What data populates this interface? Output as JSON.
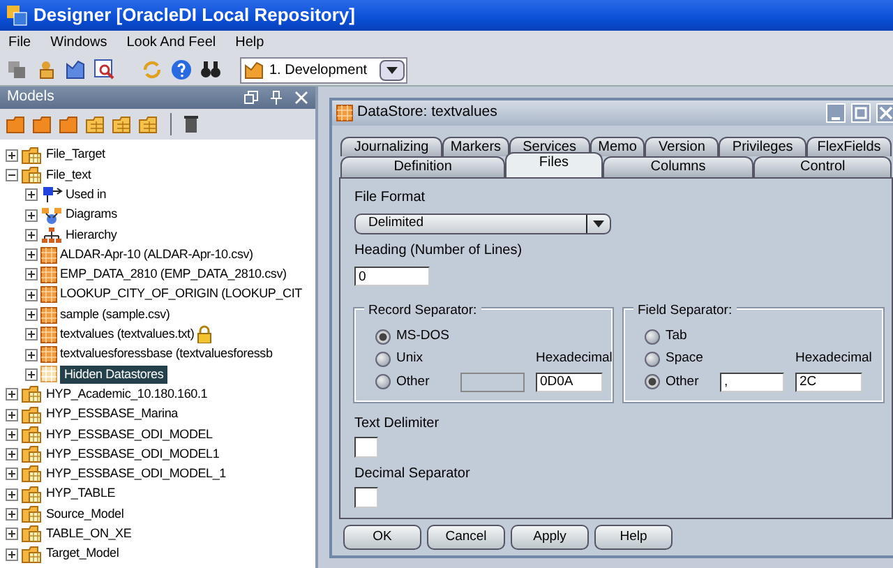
{
  "window": {
    "title": "Designer [OracleDI Local Repository]"
  },
  "menu": [
    "File",
    "Windows",
    "Look And Feel",
    "Help"
  ],
  "toolbar": {
    "context": "1. Development"
  },
  "models_panel": {
    "title": "Models",
    "tree": [
      {
        "label": "File_Target",
        "kind": "model",
        "expanded": false,
        "selected": false
      },
      {
        "label": "File_text",
        "kind": "model",
        "expanded": true,
        "selected": false,
        "children": [
          {
            "label": "Used in",
            "kind": "usedin",
            "expanded": false,
            "selected": false
          },
          {
            "label": "Diagrams",
            "kind": "diagrams",
            "expanded": false,
            "selected": false
          },
          {
            "label": "Hierarchy",
            "kind": "hierarchy",
            "expanded": false,
            "selected": false
          },
          {
            "label": "ALDAR-Apr-10 (ALDAR-Apr-10.csv)",
            "kind": "datastore",
            "expanded": false,
            "selected": false
          },
          {
            "label": "EMP_DATA_2810 (EMP_DATA_2810.csv)",
            "kind": "datastore",
            "expanded": false,
            "selected": false
          },
          {
            "label": "LOOKUP_CITY_OF_ORIGIN (LOOKUP_CIT",
            "kind": "datastore",
            "expanded": false,
            "selected": false
          },
          {
            "label": "sample (sample.csv)",
            "kind": "datastore",
            "expanded": false,
            "selected": false
          },
          {
            "label": "textvalues (textvalues.txt)",
            "kind": "datastore",
            "expanded": false,
            "selected": false,
            "locked": true
          },
          {
            "label": "textvaluesforessbase (textvaluesforessb",
            "kind": "datastore",
            "expanded": false,
            "selected": false
          },
          {
            "label": "Hidden Datastores",
            "kind": "hidden",
            "expanded": false,
            "selected": true
          }
        ]
      },
      {
        "label": "HYP_Academic_10.180.160.1",
        "kind": "model",
        "expanded": false,
        "selected": false
      },
      {
        "label": "HYP_ESSBASE_Marina",
        "kind": "model",
        "expanded": false,
        "selected": false
      },
      {
        "label": "HYP_ESSBASE_ODI_MODEL",
        "kind": "model",
        "expanded": false,
        "selected": false
      },
      {
        "label": "HYP_ESSBASE_ODI_MODEL1",
        "kind": "model",
        "expanded": false,
        "selected": false
      },
      {
        "label": "HYP_ESSBASE_ODI_MODEL_1",
        "kind": "model",
        "expanded": false,
        "selected": false
      },
      {
        "label": "HYP_TABLE",
        "kind": "model",
        "expanded": false,
        "selected": false
      },
      {
        "label": "Source_Model",
        "kind": "model",
        "expanded": false,
        "selected": false
      },
      {
        "label": "TABLE_ON_XE",
        "kind": "model",
        "expanded": false,
        "selected": false
      },
      {
        "label": "Target_Model",
        "kind": "model",
        "expanded": false,
        "selected": false
      }
    ]
  },
  "datastore": {
    "title": "DataStore: textvalues",
    "tabs_back": [
      {
        "label": "Journalizing",
        "selected": false
      },
      {
        "label": "Markers",
        "selected": false
      },
      {
        "label": "Services",
        "selected": false
      },
      {
        "label": "Memo",
        "selected": false
      },
      {
        "label": "Version",
        "selected": false
      },
      {
        "label": "Privileges",
        "selected": false
      },
      {
        "label": "FlexFields",
        "selected": false
      }
    ],
    "tabs_front": [
      {
        "label": "Definition",
        "selected": false
      },
      {
        "label": "Files",
        "selected": true
      },
      {
        "label": "Columns",
        "selected": false
      },
      {
        "label": "Control",
        "selected": false
      }
    ],
    "file_format": {
      "label": "File Format",
      "value": "Delimited"
    },
    "heading": {
      "label": "Heading (Number of Lines)",
      "value": "0"
    },
    "record_separator": {
      "title": "Record Separator:",
      "options": [
        {
          "label": "MS-DOS",
          "selected": true
        },
        {
          "label": "Unix",
          "selected": false
        },
        {
          "label": "Other",
          "selected": false
        }
      ],
      "hex_label": "Hexadecimal",
      "hex_value": "0D0A"
    },
    "field_separator": {
      "title": "Field Separator:",
      "options": [
        {
          "label": "Tab",
          "selected": false
        },
        {
          "label": "Space",
          "selected": false
        },
        {
          "label": "Other",
          "selected": true
        }
      ],
      "hex_label": "Hexadecimal",
      "other_value": ",",
      "hex_value": "2C"
    },
    "text_delimiter": {
      "label": "Text Delimiter"
    },
    "decimal_separator": {
      "label": "Decimal Separator"
    },
    "buttons": [
      "OK",
      "Cancel",
      "Apply",
      "Help"
    ]
  }
}
